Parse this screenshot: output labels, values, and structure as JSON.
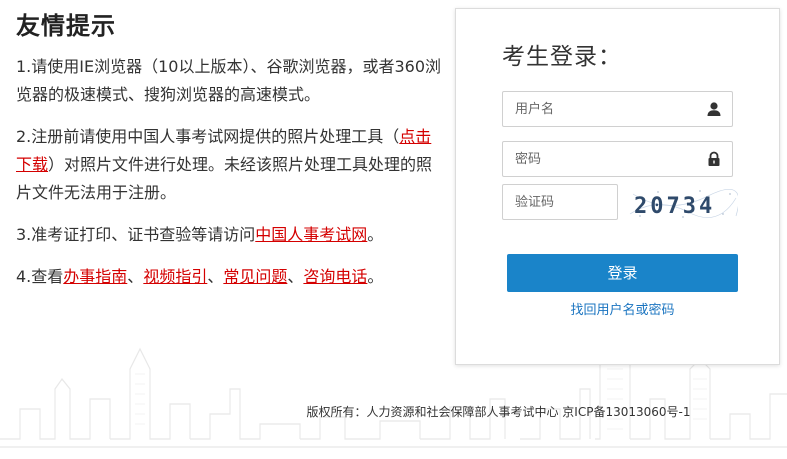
{
  "notice": {
    "title": "友情提示",
    "item1": "1.请使用IE浏览器（10以上版本）、谷歌浏览器，或者360浏览器的极速模式、搜狗浏览器的高速模式。",
    "item2_pre": "2.注册前请使用中国人事考试网提供的照片处理工具（",
    "item2_link": "点击下载",
    "item2_post": "）对照片文件进行处理。未经该照片处理工具处理的照片文件无法用于注册。",
    "item3_pre": "3.准考证打印、证书查验等请访问",
    "item3_link": "中国人事考试网",
    "item3_post": "。",
    "item4_pre": "4.查看",
    "item4_links": [
      "办事指南",
      "视频指引",
      "常见问题",
      "咨询电话"
    ],
    "item4_sep": "、",
    "item4_post": "。"
  },
  "login": {
    "title": "考生登录：",
    "username_placeholder": "用户名",
    "password_placeholder": "密码",
    "captcha_placeholder": "验证码",
    "captcha_text": "20734",
    "submit_label": "登录",
    "forgot_label": "找回用户名或密码"
  },
  "footer": {
    "copyright": "版权所有：人力资源和社会保障部人事考试中心 京ICP备13013060号-1"
  },
  "colors": {
    "accent": "#1a84c9",
    "link_red": "#d40000",
    "link_blue": "#1a74c0"
  }
}
